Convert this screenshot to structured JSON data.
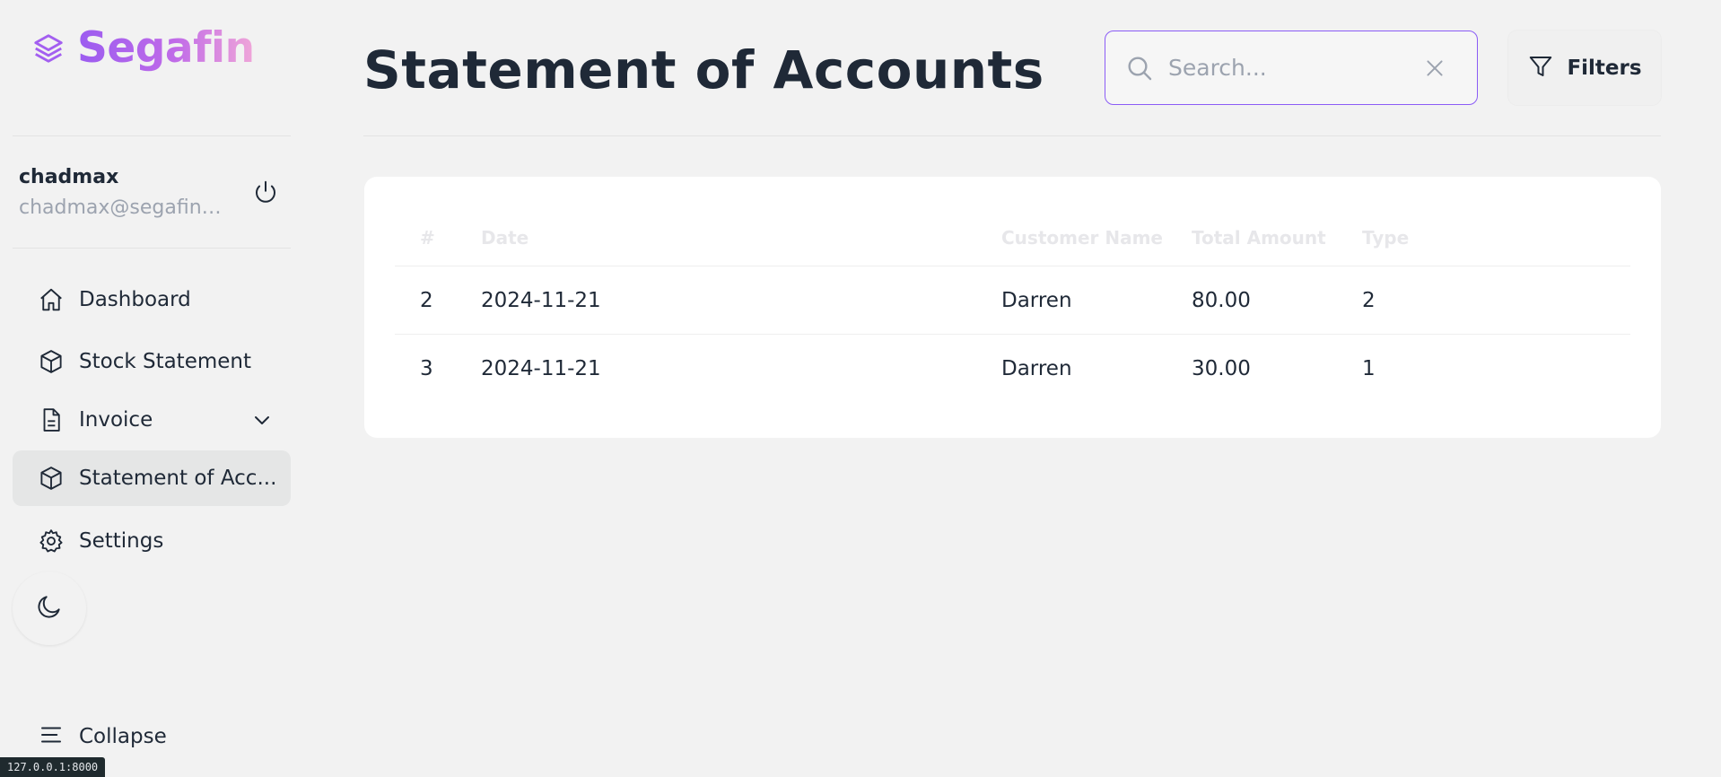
{
  "brand": {
    "name": "Segafin"
  },
  "user": {
    "name": "chadmax",
    "email": "chadmax@segafin...."
  },
  "nav": {
    "items": [
      {
        "label": "Dashboard",
        "icon": "home-icon"
      },
      {
        "label": "Stock Statement",
        "icon": "box-icon"
      },
      {
        "label": "Invoice",
        "icon": "file-icon",
        "has_submenu": true
      },
      {
        "label": "Statement of Acc...",
        "icon": "box-icon",
        "active": true
      },
      {
        "label": "Settings",
        "icon": "gear-icon"
      }
    ],
    "collapse_label": "Collapse"
  },
  "header": {
    "title": "Statement of Accounts",
    "search_placeholder": "Search...",
    "filters_label": "Filters"
  },
  "table": {
    "columns": [
      "#",
      "Date",
      "Customer Name",
      "Total Amount",
      "Type"
    ],
    "rows": [
      [
        "2",
        "2024-11-21",
        "Darren",
        "80.00",
        "2"
      ],
      [
        "3",
        "2024-11-21",
        "Darren",
        "30.00",
        "1"
      ]
    ]
  },
  "status_bar": {
    "url": "127.0.0.1:8000"
  },
  "colors": {
    "accent": "#8b5cf6",
    "brand_gradient_start": "#9b5cf0",
    "brand_gradient_end": "#f0a6d8",
    "active_bg": "#e5e6e6"
  }
}
